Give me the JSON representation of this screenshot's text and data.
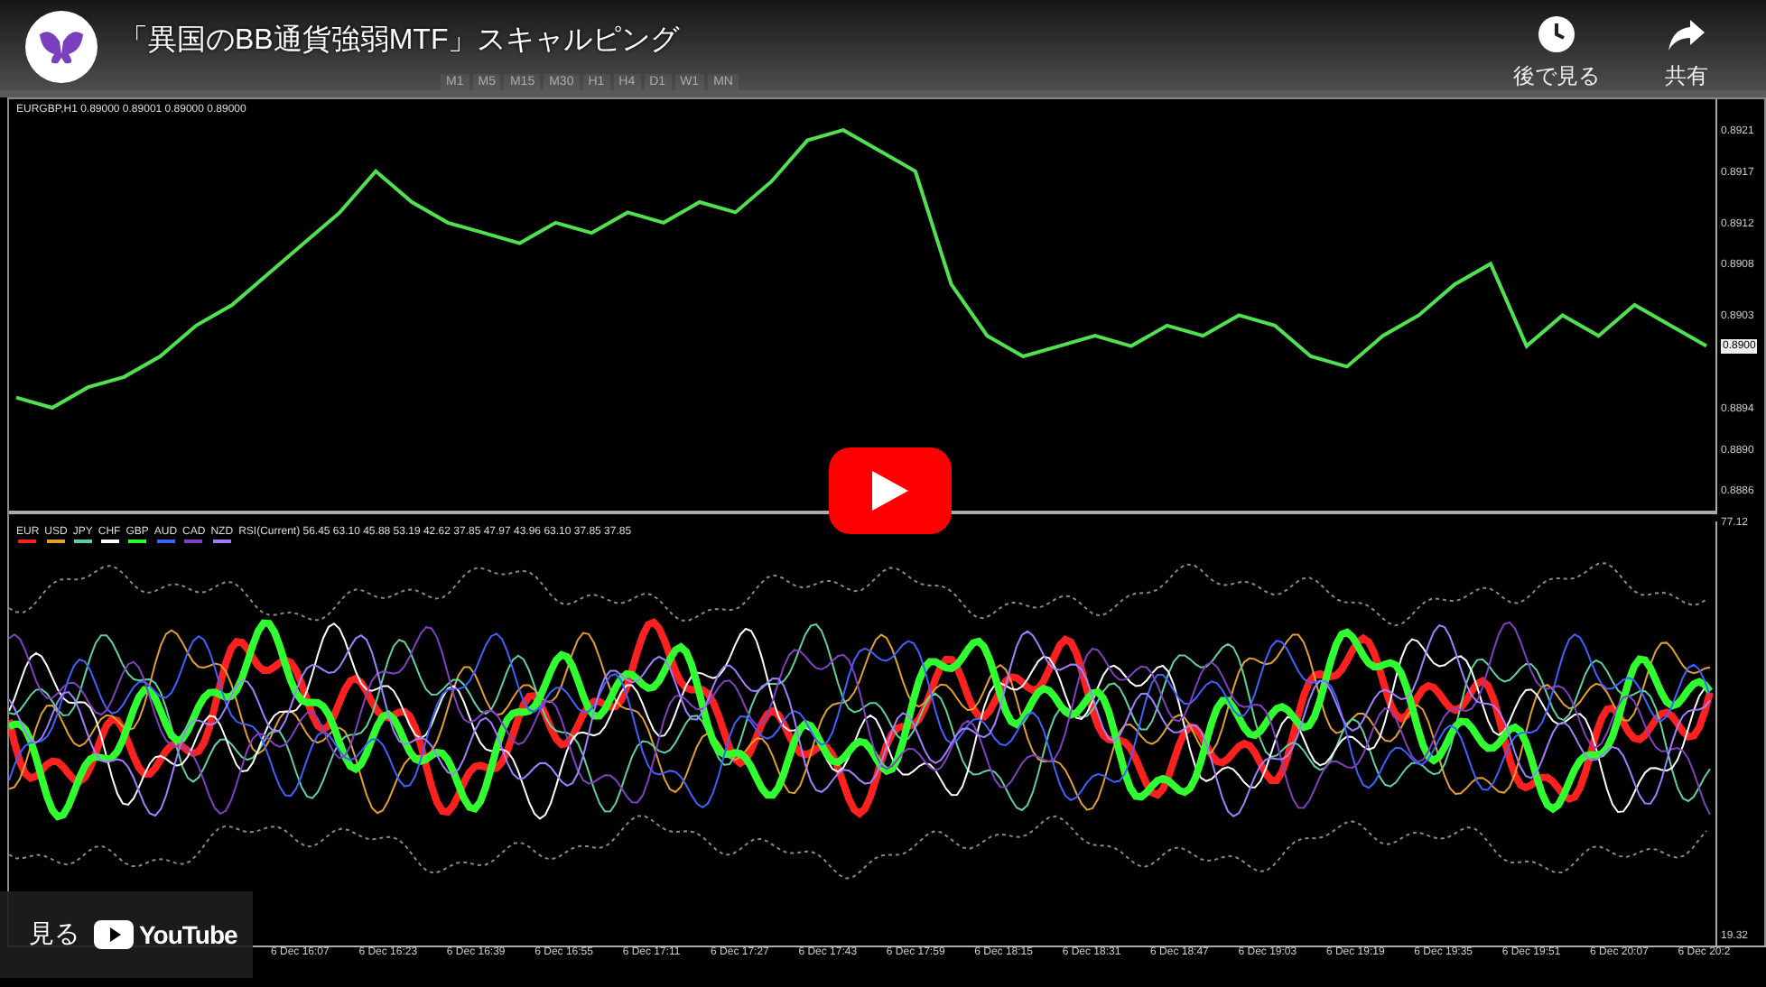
{
  "video": {
    "title": "「異国のBB通貨強弱MTF」スキャルピング"
  },
  "actions": [
    {
      "kind": "watch_later",
      "label": "後で見る"
    },
    {
      "kind": "share",
      "label": "共有"
    }
  ],
  "toolbar": {
    "timeframes": [
      "M1",
      "M5",
      "M15",
      "M30",
      "H1",
      "H4",
      "D1",
      "W1",
      "MN"
    ]
  },
  "main_chart": {
    "header": "EURGBP,H1  0.89000 0.89001 0.89000 0.89000",
    "current_price": "0.8900",
    "chart_data": {
      "type": "line",
      "ylim": [
        0.8884,
        0.8924
      ],
      "yticks": [
        {
          "value": 0.8921,
          "label": "0.8921"
        },
        {
          "value": 0.8917,
          "label": "0.8917"
        },
        {
          "value": 0.8912,
          "label": "0.8912"
        },
        {
          "value": 0.8908,
          "label": "0.8908"
        },
        {
          "value": 0.8903,
          "label": "0.8903"
        },
        {
          "value": 0.8894,
          "label": "0.8894"
        },
        {
          "value": 0.889,
          "label": "0.8890"
        },
        {
          "value": 0.8886,
          "label": "0.8886"
        }
      ],
      "series": [
        {
          "color": "#50e050",
          "values": [
            0.8895,
            0.8894,
            0.8896,
            0.8897,
            0.8899,
            0.8902,
            0.8904,
            0.8907,
            0.891,
            0.8913,
            0.8917,
            0.8914,
            0.8912,
            0.8911,
            0.891,
            0.8912,
            0.8911,
            0.8913,
            0.8912,
            0.8914,
            0.8913,
            0.8916,
            0.892,
            0.8921,
            0.8919,
            0.8917,
            0.8906,
            0.8901,
            0.8899,
            0.89,
            0.8901,
            0.89,
            0.8902,
            0.8901,
            0.8903,
            0.8902,
            0.8899,
            0.8898,
            0.8901,
            0.8903,
            0.8906,
            0.8908,
            0.89,
            0.8903,
            0.8901,
            0.8904,
            0.8902,
            0.89
          ]
        }
      ]
    }
  },
  "rsi_panel": {
    "currencies": [
      {
        "name": "EUR",
        "color": "#ff2020"
      },
      {
        "name": "USD",
        "color": "#e0a030"
      },
      {
        "name": "JPY",
        "color": "#60d0a0"
      },
      {
        "name": "CHF",
        "color": "#ffffff"
      },
      {
        "name": "GBP",
        "color": "#30ff30"
      },
      {
        "name": "AUD",
        "color": "#4060ff"
      },
      {
        "name": "CAD",
        "color": "#8040c0"
      },
      {
        "name": "NZD",
        "color": "#a080ff"
      }
    ],
    "header": "RSI(Current) 56.45 63.10 45.88 53.19 42.62 37.85 47.97 43.96 63.10 37.85 37.85",
    "top_tick": "77.12",
    "bottom_tick": "19.32"
  },
  "time_axis": [
    "6 Dec 16:07",
    "6 Dec 16:23",
    "6 Dec 16:39",
    "6 Dec 16:55",
    "6 Dec 17:11",
    "6 Dec 17:27",
    "6 Dec 17:43",
    "6 Dec 17:59",
    "6 Dec 18:15",
    "6 Dec 18:31",
    "6 Dec 18:47",
    "6 Dec 19:03",
    "6 Dec 19:19",
    "6 Dec 19:35",
    "6 Dec 19:51",
    "6 Dec 20:07",
    "6 Dec 20:2"
  ],
  "watch_on": {
    "label": "見る",
    "brand": "YouTube"
  }
}
